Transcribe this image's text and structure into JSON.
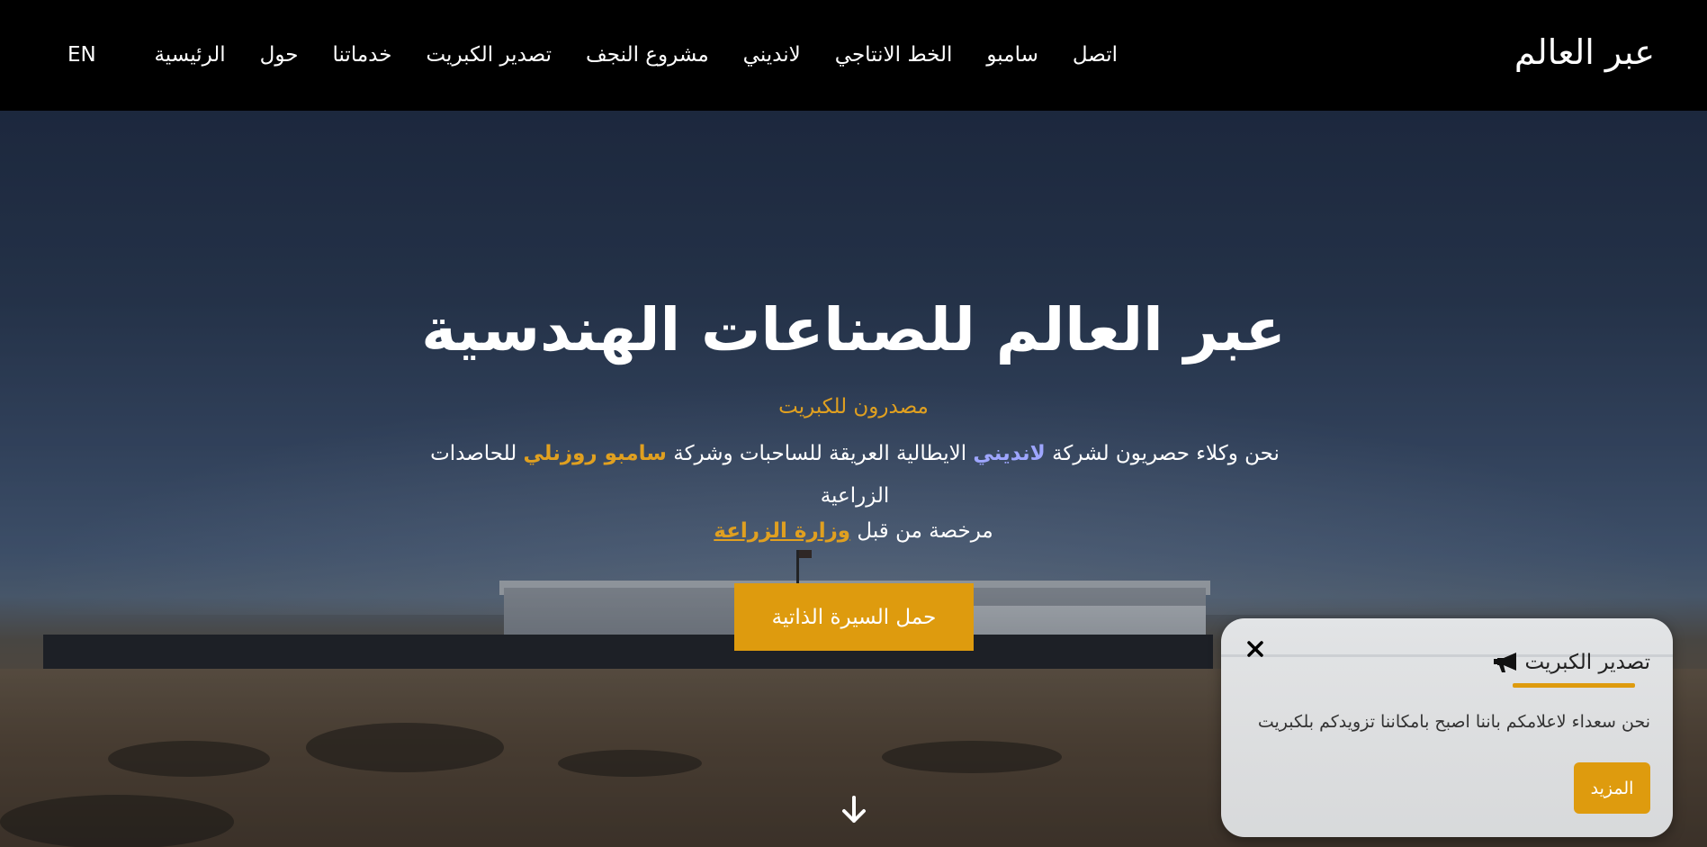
{
  "navbar": {
    "brand": "عبر العالم",
    "links": [
      {
        "label": "الرئيسية"
      },
      {
        "label": "حول"
      },
      {
        "label": "خدماتنا"
      },
      {
        "label": "تصدير الكبريت"
      },
      {
        "label": "مشروع النجف"
      },
      {
        "label": "لانديني"
      },
      {
        "label": "الخط الانتاجي"
      },
      {
        "label": "سامبو"
      },
      {
        "label": "اتصل"
      }
    ],
    "language": "EN"
  },
  "hero": {
    "title": "عبر العالم للصناعات الهندسية",
    "subtitle": "مصدرون للكبريت",
    "desc_part1": "نحن وكلاء حصريون لشركة ",
    "desc_brand1": "لانديني",
    "desc_part2": " الايطالية العريقة للساحبات وشركة ",
    "desc_brand2": "سامبو روزنلي",
    "desc_part3": " للحاصدات الزراعية",
    "license_text": "مرخصة من قبل ",
    "license_ministry": "وزارة الزراعة",
    "cv_button": "حمل السيرة الذاتية",
    "scroll_icon": "arrow-down-icon"
  },
  "popup": {
    "title": "تصدير الكبريت",
    "title_icon": "megaphone-icon",
    "text": "نحن سعداء لاعلامكم باننا اصبح بامكاننا تزويدكم بلكبريت",
    "more_button": "المزيد",
    "close_icon": "close-icon"
  },
  "colors": {
    "accent": "#de9b0e",
    "brand_highlight": "#9ea6ff",
    "navbar_bg": "#000000"
  }
}
